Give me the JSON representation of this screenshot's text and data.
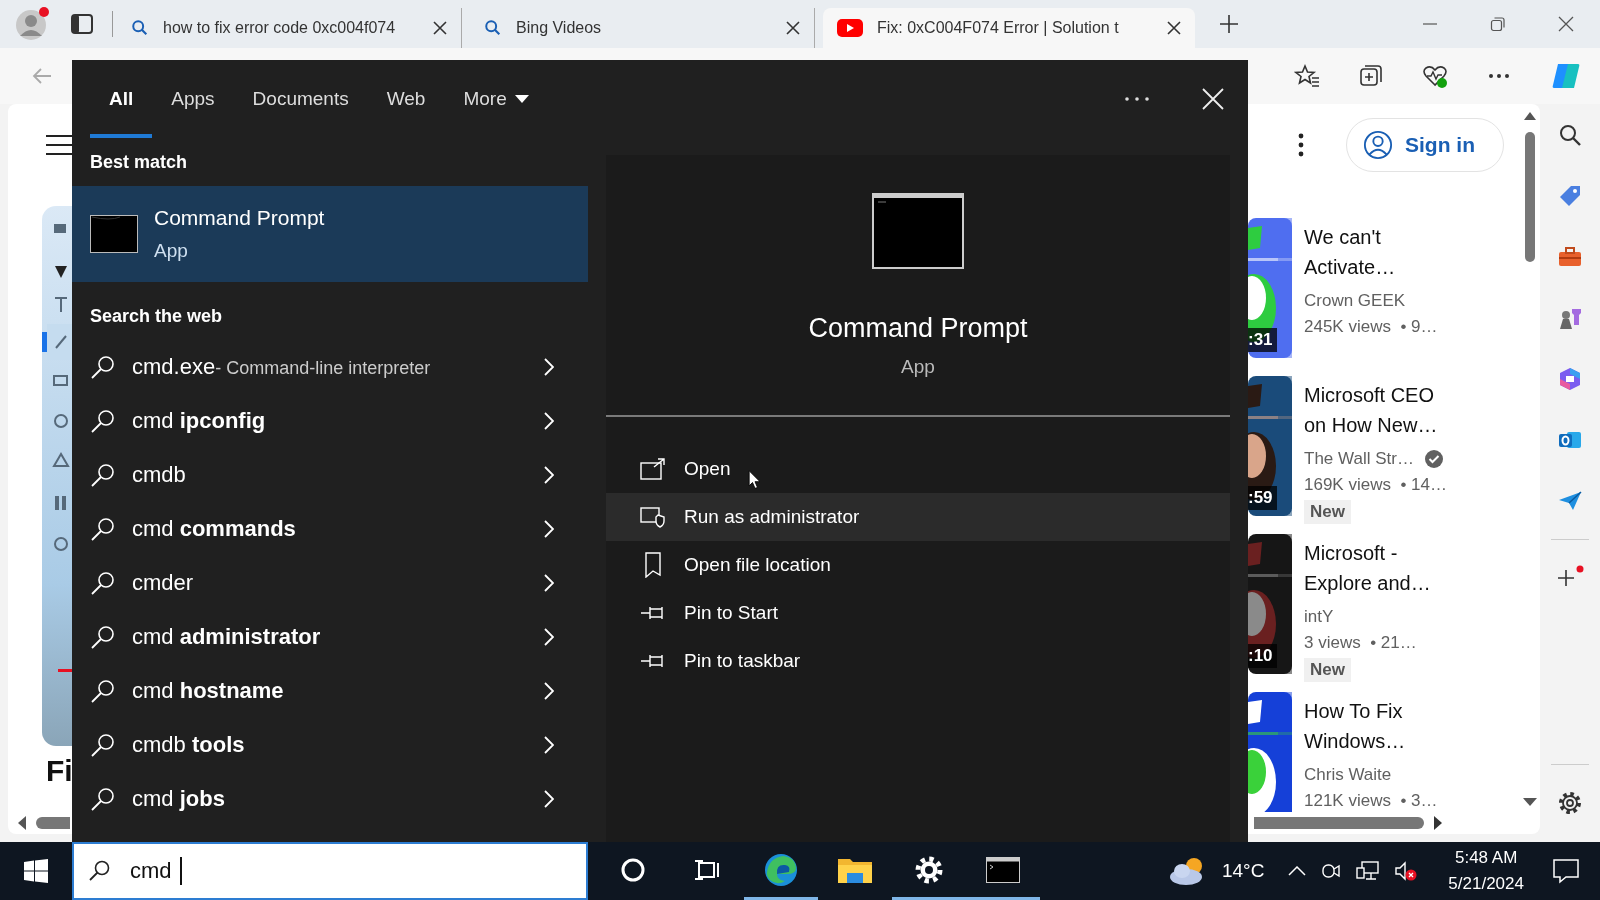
{
  "browser": {
    "tabs": [
      {
        "title": "how to fix error code 0xc004f074",
        "selected": false
      },
      {
        "title": "Bing Videos",
        "selected": false
      },
      {
        "title": "Fix: 0xC004F074 Error | Solution t",
        "selected": true
      }
    ]
  },
  "page": {
    "heading": "Fi",
    "sign_in": "Sign in",
    "videos": [
      {
        "title": "We can't Activate…",
        "channel": "Crown GEEK",
        "verified": false,
        "stats": "245K views  • 9…",
        "duration": ":31"
      },
      {
        "title": "Microsoft CEO on How New…",
        "channel": "The Wall Str…",
        "verified": true,
        "stats": "169K views  • 14…",
        "duration": ":59",
        "badge": "New"
      },
      {
        "title": "Microsoft - Explore and…",
        "channel": "intY",
        "verified": false,
        "stats": "3 views  • 21…",
        "duration": ":10",
        "badge": "New"
      },
      {
        "title": "How To Fix Windows…",
        "channel": "Chris Waite",
        "verified": false,
        "stats": "121K views  • 3…"
      }
    ]
  },
  "search_panel": {
    "tabs": [
      {
        "label": "All",
        "selected": true,
        "dropdown": false
      },
      {
        "label": "Apps",
        "selected": false,
        "dropdown": false
      },
      {
        "label": "Documents",
        "selected": false,
        "dropdown": false
      },
      {
        "label": "Web",
        "selected": false,
        "dropdown": false
      },
      {
        "label": "More",
        "selected": false,
        "dropdown": true
      }
    ],
    "best_match_heading": "Best match",
    "best_match": {
      "name": "Command Prompt",
      "type": "App",
      "selected": true
    },
    "web_heading": "Search the web",
    "suggestions": [
      {
        "text": "cmd.exe",
        "detail": "- Command-line interpreter"
      },
      {
        "text": "cmd **ipconfig**"
      },
      {
        "text": "cmdb"
      },
      {
        "text": "cmd **commands**"
      },
      {
        "text": "cmder"
      },
      {
        "text": "cmd **administrator**"
      },
      {
        "text": "cmd **hostname**"
      },
      {
        "text": "cmdb **tools**"
      },
      {
        "text": "cmd **jobs**"
      }
    ],
    "preview": {
      "name": "Command Prompt",
      "type": "App",
      "actions": [
        {
          "label": "Open",
          "hovered": false
        },
        {
          "label": "Run as administrator",
          "hovered": true
        },
        {
          "label": "Open file location",
          "hovered": false
        },
        {
          "label": "Pin to Start",
          "hovered": false
        },
        {
          "label": "Pin to taskbar",
          "hovered": false
        }
      ]
    }
  },
  "taskbar": {
    "search": {
      "value": "cmd"
    },
    "apps": [
      {
        "kind": "cortana",
        "running": false
      },
      {
        "kind": "taskview",
        "running": false
      },
      {
        "kind": "edge",
        "running": true
      },
      {
        "kind": "files",
        "running": false
      },
      {
        "kind": "settings",
        "running": true
      },
      {
        "kind": "terminal",
        "running": true
      }
    ],
    "weather": "14°C",
    "time": "5:48 AM",
    "date": "5/21/2024"
  }
}
